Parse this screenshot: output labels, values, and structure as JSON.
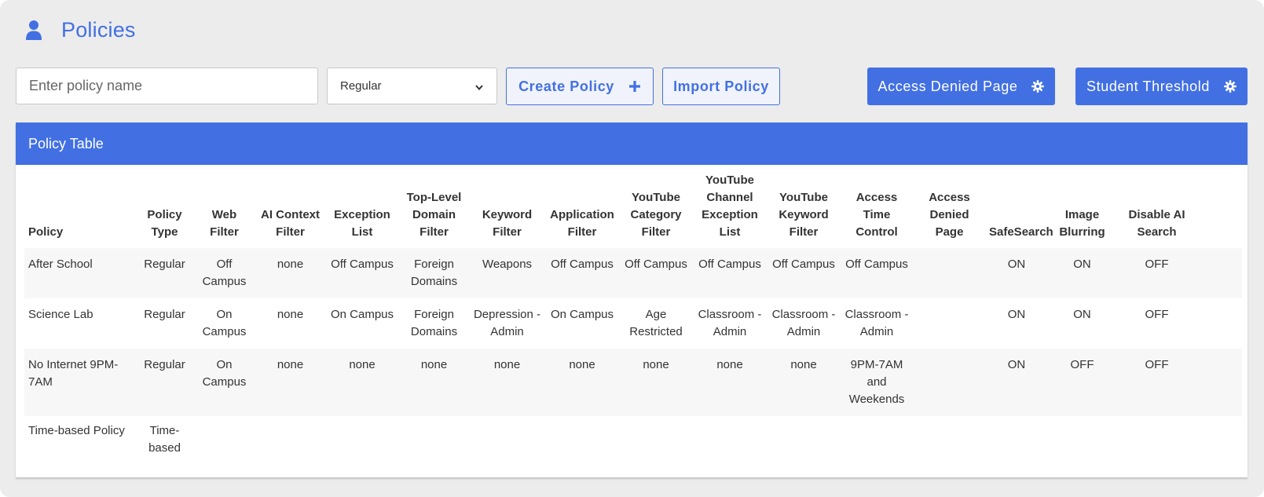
{
  "header": {
    "title": "Policies",
    "icon": "user-icon"
  },
  "controls": {
    "policy_name_placeholder": "Enter policy name",
    "policy_type_selected": "Regular",
    "create_label": "Create Policy",
    "import_label": "Import Policy",
    "access_denied_label": "Access Denied Page",
    "student_threshold_label": "Student Threshold"
  },
  "colors": {
    "accent": "#4270e3",
    "background": "#ececec"
  },
  "table": {
    "title": "Policy Table",
    "columns": [
      "Policy",
      "Policy Type",
      "Web Filter",
      "AI Context Filter",
      "Exception List",
      "Top-Level Domain Filter",
      "Keyword Filter",
      "Application Filter",
      "YouTube Category Filter",
      "YouTube Channel Exception List",
      "YouTube Keyword Filter",
      "Access Time Control",
      "Access Denied Page",
      "SafeSearch",
      "Image Blurring",
      "Disable AI Search"
    ],
    "rows": [
      [
        "After School",
        "Regular",
        "Off Campus",
        "none",
        "Off Campus",
        "Foreign Domains",
        "Weapons",
        "Off Campus",
        "Off Campus",
        "Off Campus",
        "Off Campus",
        "Off Campus",
        "",
        "ON",
        "ON",
        "OFF"
      ],
      [
        "Science Lab",
        "Regular",
        "On Campus",
        "none",
        "On Campus",
        "Foreign Domains",
        "Depression - Admin",
        "On Campus",
        "Age Restricted",
        "Classroom - Admin",
        "Classroom - Admin",
        "Classroom - Admin",
        "",
        "ON",
        "ON",
        "OFF"
      ],
      [
        "No Internet 9PM-7AM",
        "Regular",
        "On Campus",
        "none",
        "none",
        "none",
        "none",
        "none",
        "none",
        "none",
        "none",
        "9PM-7AM and Weekends",
        "",
        "ON",
        "OFF",
        "OFF"
      ],
      [
        "Time-based Policy",
        "Time-based",
        "",
        "",
        "",
        "",
        "",
        "",
        "",
        "",
        "",
        "",
        "",
        "",
        "",
        ""
      ]
    ]
  }
}
